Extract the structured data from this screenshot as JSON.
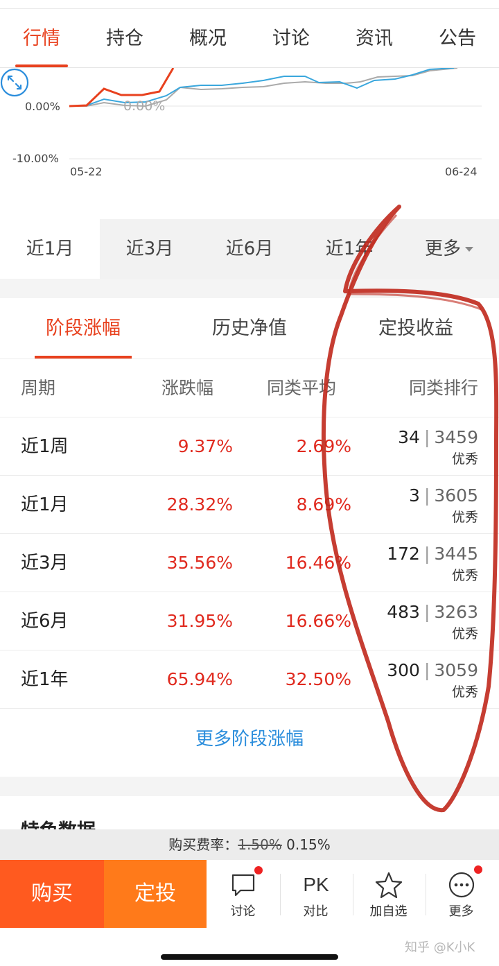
{
  "top_tabs": [
    {
      "label": "行情",
      "active": true
    },
    {
      "label": "持仓",
      "active": false
    },
    {
      "label": "概况",
      "active": false
    },
    {
      "label": "讨论",
      "active": false
    },
    {
      "label": "资讯",
      "active": false
    },
    {
      "label": "公告",
      "active": false
    }
  ],
  "chart": {
    "y_labels": [
      "0.00%",
      "-10.00%"
    ],
    "overlay_label": "0.00%",
    "x_start": "05-22",
    "x_end": "06-24",
    "expand_icon": "expand-arrows-icon",
    "colors": {
      "fund": "#e8411e",
      "peer_avg": "#3aa7dd",
      "index": "#aaaaaa"
    }
  },
  "periods": [
    {
      "label": "近1月",
      "active": true
    },
    {
      "label": "近3月",
      "active": false
    },
    {
      "label": "近6月",
      "active": false
    },
    {
      "label": "近1年",
      "active": false
    },
    {
      "label": "更多",
      "active": false
    }
  ],
  "perf_tabs": [
    {
      "label": "阶段涨幅",
      "active": true
    },
    {
      "label": "历史净值",
      "active": false
    },
    {
      "label": "定投收益",
      "active": false
    }
  ],
  "table": {
    "headers": [
      "周期",
      "涨跌幅",
      "同类平均",
      "同类排行"
    ],
    "rows": [
      {
        "period": "近1周",
        "change": "9.37%",
        "avg": "2.69%",
        "rank": "34",
        "total": "3459",
        "level": "优秀"
      },
      {
        "period": "近1月",
        "change": "28.32%",
        "avg": "8.69%",
        "rank": "3",
        "total": "3605",
        "level": "优秀"
      },
      {
        "period": "近3月",
        "change": "35.56%",
        "avg": "16.46%",
        "rank": "172",
        "total": "3445",
        "level": "优秀"
      },
      {
        "period": "近6月",
        "change": "31.95%",
        "avg": "16.66%",
        "rank": "483",
        "total": "3263",
        "level": "优秀"
      },
      {
        "period": "近1年",
        "change": "65.94%",
        "avg": "32.50%",
        "rank": "300",
        "total": "3059",
        "level": "优秀"
      }
    ],
    "separator": "|",
    "more_link": "更多阶段涨幅"
  },
  "feature": {
    "title": "特色数据"
  },
  "fee": {
    "label": "购买费率：",
    "old": "1.50%",
    "new": "0.15%"
  },
  "actions": {
    "buy": "购买",
    "sip": "定投",
    "tools": [
      {
        "label": "讨论",
        "icon": "chat-bubble-icon",
        "badge": true
      },
      {
        "label": "对比",
        "icon": "pk-icon",
        "icon_text": "PK",
        "badge": false
      },
      {
        "label": "加自选",
        "icon": "star-icon",
        "badge": false
      },
      {
        "label": "更多",
        "icon": "more-dots-icon",
        "badge": true
      }
    ]
  },
  "watermark": "知乎 @K小K",
  "colors": {
    "accent": "#e8411e",
    "up_red": "#e02a1f",
    "link_blue": "#2a8ddc",
    "buy": "#ff5a1f",
    "sip": "#ff7a1a",
    "annotation": "#c0281c"
  }
}
